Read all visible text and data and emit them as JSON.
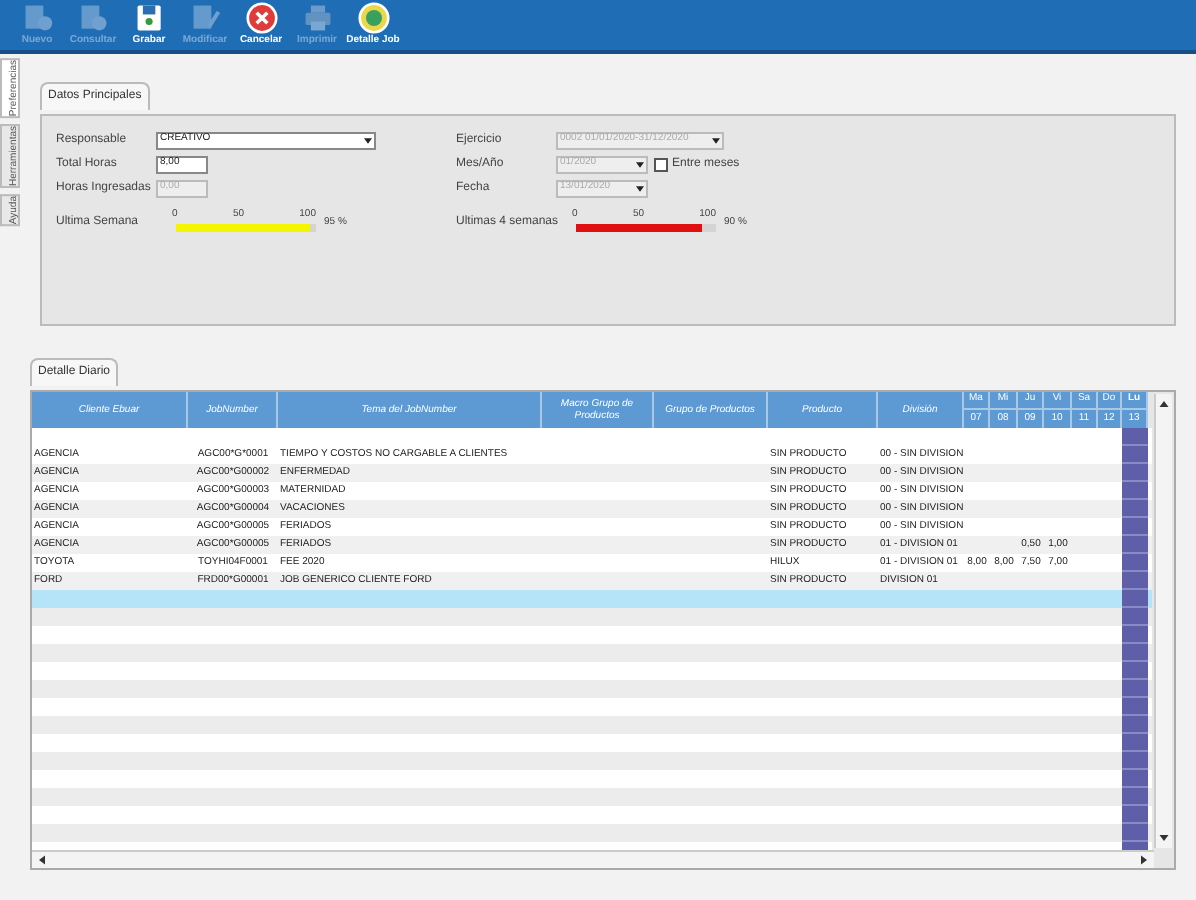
{
  "toolbar": [
    {
      "label": "Nuevo",
      "kind": "new",
      "disabled": true
    },
    {
      "label": "Consultar",
      "kind": "query",
      "disabled": true
    },
    {
      "label": "Grabar",
      "kind": "save",
      "disabled": false
    },
    {
      "label": "Modificar",
      "kind": "edit",
      "disabled": true
    },
    {
      "label": "Cancelar",
      "kind": "cancel",
      "disabled": false
    },
    {
      "label": "Imprimir",
      "kind": "print",
      "disabled": true
    },
    {
      "label": "Detalle Job",
      "kind": "detail",
      "disabled": false
    }
  ],
  "side_tabs": [
    {
      "label": "Preferencias",
      "selected": true
    },
    {
      "label": "Herramientas",
      "selected": false
    },
    {
      "label": "Ayuda",
      "selected": false
    }
  ],
  "main_panel": {
    "tab": "Datos Principales",
    "responsable": {
      "label": "Responsable",
      "value": "CREATIVO"
    },
    "total_horas": {
      "label": "Total Horas",
      "value": "8,00"
    },
    "horas_ingresadas": {
      "label": "Horas Ingresadas",
      "value": "0,00",
      "disabled": true
    },
    "ejercicio": {
      "label": "Ejercicio",
      "value": "0002 01/01/2020-31/12/2020",
      "disabled": true
    },
    "mes_anio": {
      "label": "Mes/Año",
      "value": "01/2020",
      "disabled": true
    },
    "entre_meses": {
      "label": "Entre meses",
      "checked": false
    },
    "fecha": {
      "label": "Fecha",
      "value": "13/01/2020",
      "disabled": true
    },
    "meters": [
      {
        "label": "Ultima Semana",
        "level": 0.95,
        "reading": "95 %",
        "color": "#f5f500",
        "ticks": [
          "0",
          "50",
          "100"
        ]
      },
      {
        "label": "Ultimas 4 semanas",
        "level": 0.9,
        "reading": "90 %",
        "color": "#e01010",
        "ticks": [
          "0",
          "50",
          "100"
        ]
      }
    ]
  },
  "detail_panel": {
    "tab": "Detalle Diario",
    "columns": [
      "Cliente Ebuar",
      "JobNumber",
      "Tema del JobNumber",
      "Macro Grupo de Productos",
      "Grupo de Productos",
      "Producto",
      "División"
    ],
    "days": [
      {
        "name": "Ma",
        "date": "07",
        "highlighted": false
      },
      {
        "name": "Mi",
        "date": "08",
        "highlighted": false
      },
      {
        "name": "Ju",
        "date": "09",
        "highlighted": false
      },
      {
        "name": "Vi",
        "date": "10",
        "highlighted": false
      },
      {
        "name": "Sa",
        "date": "11",
        "highlighted": false
      },
      {
        "name": "Do",
        "date": "12",
        "highlighted": false
      },
      {
        "name": "Lu",
        "date": "13",
        "highlighted": true
      }
    ],
    "rows": [
      {
        "cliente": "AGENCIA",
        "job": "AGC00*G*0001",
        "tema": "TIEMPO Y COSTOS NO CARGABLE A CLIENTES",
        "producto": "SIN PRODUCTO",
        "division": "00 - SIN DIVISION"
      },
      {
        "cliente": "AGENCIA",
        "job": "AGC00*G00002",
        "tema": "ENFERMEDAD",
        "producto": "SIN PRODUCTO",
        "division": "00 - SIN DIVISION"
      },
      {
        "cliente": "AGENCIA",
        "job": "AGC00*G00003",
        "tema": "MATERNIDAD",
        "producto": "SIN PRODUCTO",
        "division": "00 - SIN DIVISION"
      },
      {
        "cliente": "AGENCIA",
        "job": "AGC00*G00004",
        "tema": "VACACIONES",
        "producto": "SIN PRODUCTO",
        "division": "00 - SIN DIVISION"
      },
      {
        "cliente": "AGENCIA",
        "job": "AGC00*G00005",
        "tema": "FERIADOS",
        "producto": "SIN PRODUCTO",
        "division": "00 - SIN DIVISION"
      },
      {
        "cliente": "AGENCIA",
        "job": "AGC00*G00005",
        "tema": "FERIADOS",
        "producto": "SIN PRODUCTO",
        "division": "01 - DIVISION 01",
        "hours": {
          "ju": "0,50",
          "vi": "1,00"
        }
      },
      {
        "cliente": "TOYOTA",
        "job": "TOYHI04F0001",
        "tema": "FEE 2020",
        "producto": "HILUX",
        "division": "01 - DIVISION 01",
        "hours": {
          "ma": "8,00",
          "mi": "8,00",
          "ju": "7,50",
          "vi": "7,00"
        }
      },
      {
        "cliente": "FORD",
        "job": "FRD00*G00001",
        "tema": "JOB GENERICO CLIENTE FORD",
        "producto": "SIN PRODUCTO",
        "division": "DIVISION 01"
      }
    ]
  }
}
